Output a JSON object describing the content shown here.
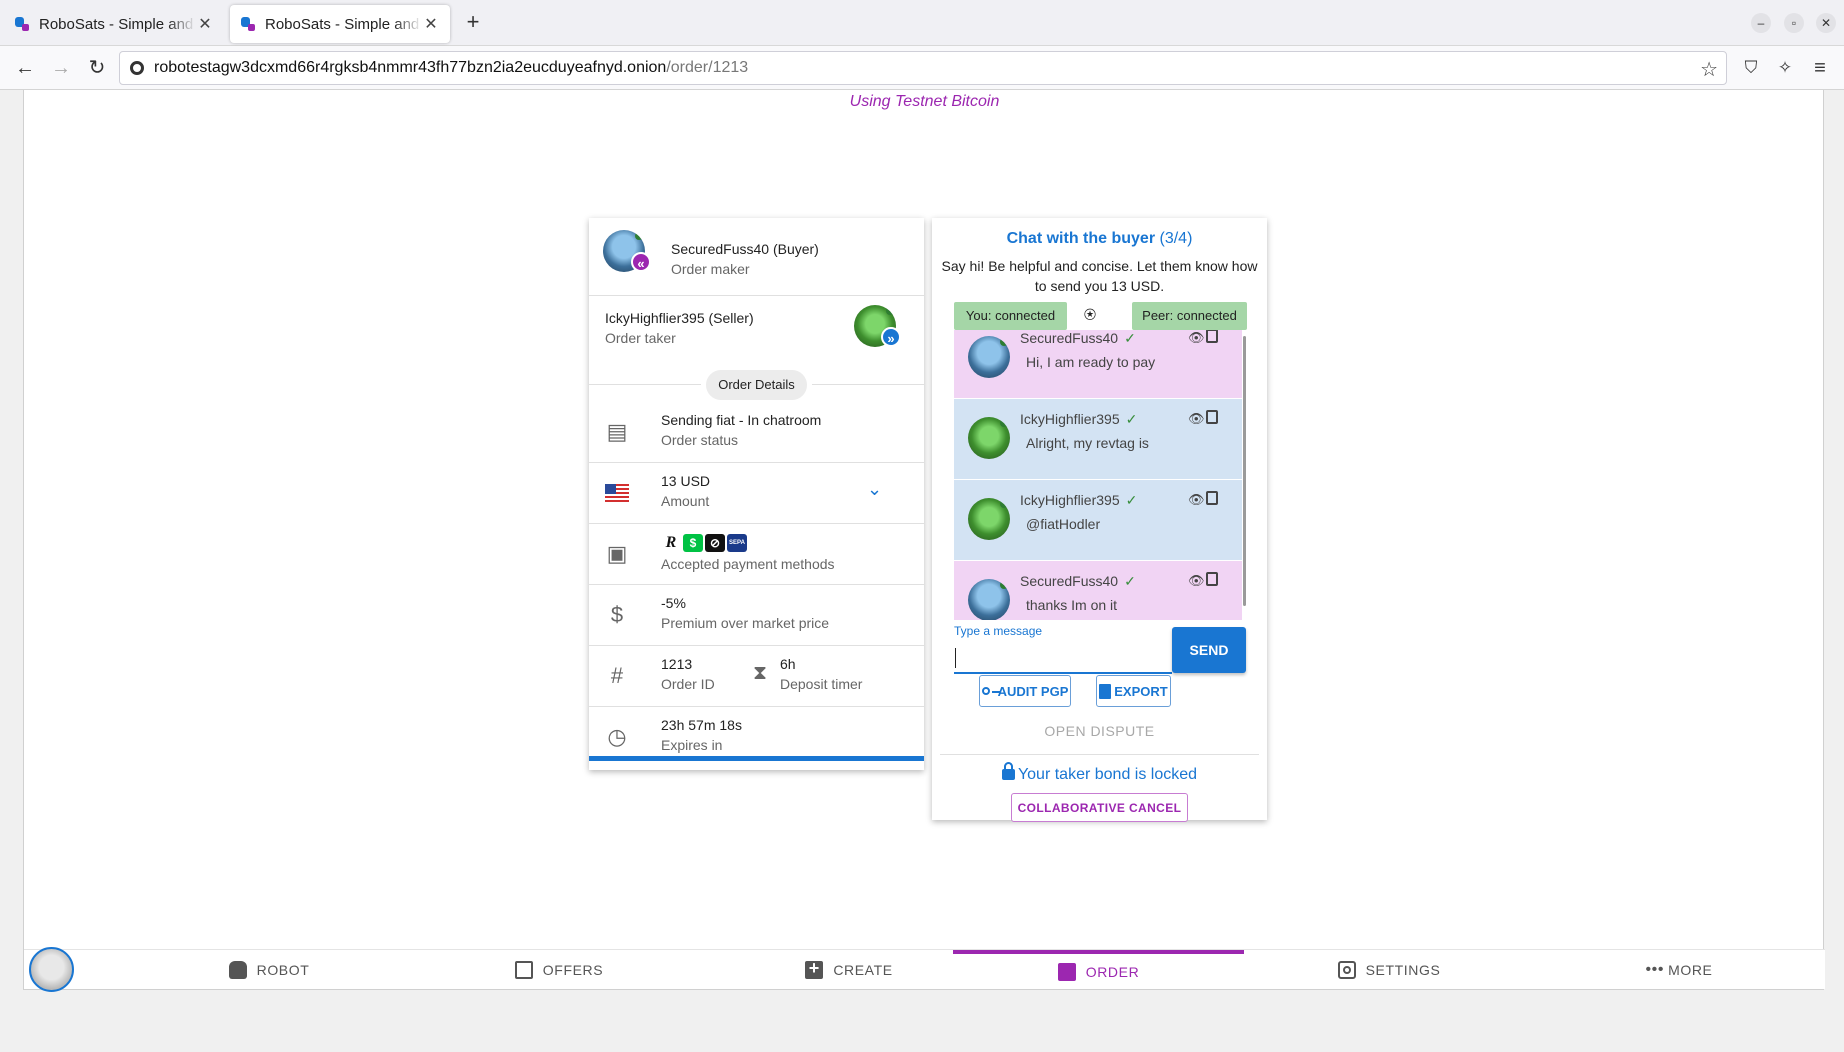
{
  "browser": {
    "tabs": [
      {
        "title": "RoboSats - Simple and Private Bitcoin Exchange",
        "active": false
      },
      {
        "title": "RoboSats - Simple and Private Bitcoin Exchange",
        "active": true
      }
    ],
    "url_host": "robotestagw3dcxmd66r4rgksb4nmmr43fh77bzn2ia2eucduyeafnyd.onion",
    "url_path": "/order/1213"
  },
  "banner": "Using Testnet Bitcoin",
  "order": {
    "maker": {
      "name": "SecuredFuss40 (Buyer)",
      "role": "Order maker"
    },
    "taker": {
      "name": "IckyHighflier395 (Seller)",
      "role": "Order taker"
    },
    "details_label": "Order Details",
    "status": {
      "value": "Sending fiat - In chatroom",
      "label": "Order status"
    },
    "amount": {
      "value": "13 USD",
      "label": "Amount"
    },
    "payment_methods": {
      "label": "Accepted payment methods",
      "icons": [
        "revolut-icon",
        "cashapp-icon",
        "wise-icon",
        "sepa-icon"
      ]
    },
    "premium": {
      "value": "-5%",
      "label": "Premium over market price"
    },
    "order_id": {
      "value": "1213",
      "label": "Order ID"
    },
    "deposit_timer": {
      "value": "6h",
      "label": "Deposit timer"
    },
    "expires": {
      "value": "23h 57m 18s",
      "label": "Expires in"
    }
  },
  "chat": {
    "title": "Chat with the buyer",
    "count": "(3/4)",
    "description": "Say hi! Be helpful and concise. Let them know how to send you 13 USD.",
    "you_status": "You: connected",
    "peer_status": "Peer: connected",
    "messages": [
      {
        "author": "SecuredFuss40",
        "text": "Hi, I am ready to pay",
        "side": "me"
      },
      {
        "author": "IckyHighflier395",
        "text": "Alright, my revtag is",
        "side": "peer"
      },
      {
        "author": "IckyHighflier395",
        "text": "@fiatHodler",
        "side": "peer"
      },
      {
        "author": "SecuredFuss40",
        "text": "thanks Im on it",
        "side": "me"
      }
    ],
    "input_label": "Type a message",
    "input_value": "",
    "send_label": "SEND",
    "audit_label": "AUDIT PGP",
    "export_label": "EXPORT",
    "dispute_label": "OPEN DISPUTE",
    "bond_text": "Your taker bond is locked",
    "collab_cancel_label": "COLLABORATIVE CANCEL"
  },
  "bottom_nav": {
    "robot": "ROBOT",
    "offers": "OFFERS",
    "create": "CREATE",
    "order": "ORDER",
    "settings": "SETTINGS",
    "more": "MORE"
  },
  "colors": {
    "primary": "#1976d2",
    "secondary": "#9c27b0",
    "connected": "#a5d6a7"
  }
}
